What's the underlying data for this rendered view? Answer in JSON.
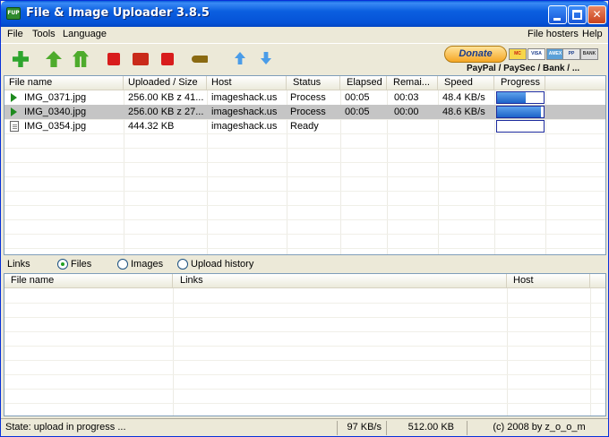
{
  "window": {
    "title": "File & Image Uploader 3.8.5",
    "app_icon_text": "FUP"
  },
  "menu": {
    "left": [
      "File",
      "Tools",
      "Language"
    ],
    "right": [
      "File hosters",
      "Help"
    ]
  },
  "toolbar": {
    "icons": [
      "add-icon",
      "upload-icon",
      "upload-all-icon",
      "stop-icon",
      "skip-icon",
      "stop-all-icon",
      "key-icon",
      "move-up-icon",
      "move-down-icon"
    ],
    "donate_label": "Donate",
    "cards": [
      "MC",
      "VISA",
      "AMEX",
      "PP",
      "BANK"
    ],
    "payment_text": "PayPal / PaySec / Bank / ..."
  },
  "upload_list": {
    "columns": [
      "File name",
      "Uploaded / Size",
      "Host",
      "Status",
      "Elapsed",
      "Remai...",
      "Speed",
      "Progress"
    ],
    "rows": [
      {
        "name": "IMG_0371.jpg",
        "size": "256.00 KB z 41...",
        "host": "imageshack.us",
        "status": "Process",
        "elapsed": "00:05",
        "remaining": "00:03",
        "speed": "48.4 KB/s",
        "progress": 0.62,
        "icon": "play-icon",
        "selected": false
      },
      {
        "name": "IMG_0340.jpg",
        "size": "256.00 KB z 27...",
        "host": "imageshack.us",
        "status": "Process",
        "elapsed": "00:05",
        "remaining": "00:00",
        "speed": "48.6 KB/s",
        "progress": 0.94,
        "icon": "play-icon",
        "selected": true
      },
      {
        "name": "IMG_0354.jpg",
        "size": "444.32 KB",
        "host": "imageshack.us",
        "status": "Ready",
        "elapsed": "",
        "remaining": "",
        "speed": "",
        "progress": 0,
        "icon": "file-icon",
        "selected": false
      }
    ]
  },
  "links": {
    "label": "Links",
    "options": [
      {
        "label": "Files",
        "checked": true
      },
      {
        "label": "Images",
        "checked": false
      },
      {
        "label": "Upload history",
        "checked": false
      }
    ],
    "columns": [
      "File name",
      "Links",
      "Host"
    ]
  },
  "statusbar": {
    "state": "State: upload in progress ...",
    "speed": "97 KB/s",
    "total": "512.00 KB",
    "copyright": "(c) 2008 by z_o_o_m"
  },
  "colors": {
    "titlebar": "#0552d6",
    "progress_fill": "#1d63c8",
    "selected_row": "#c5c5c5"
  }
}
